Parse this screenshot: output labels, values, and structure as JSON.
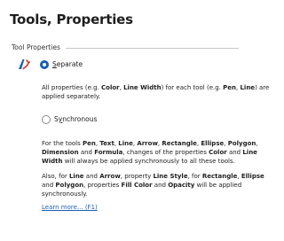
{
  "page": {
    "title": "Tools, Properties"
  },
  "group": {
    "title": "Tool Properties"
  },
  "options": {
    "separate": {
      "label_pre": "",
      "label_accel": "S",
      "label_post": "eparate",
      "checked": true
    },
    "synchronous": {
      "label_pre": "S",
      "label_accel": "y",
      "label_post": "nchronous",
      "checked": false
    }
  },
  "separate_desc": {
    "t1": "All properties (e.g. ",
    "b1": "Color",
    "t2": ", ",
    "b2": "Line Width",
    "t3": ") for each tool (e.g. ",
    "b3": "Pen",
    "t4": ", ",
    "b4": "Line",
    "t5": ") are applied separately."
  },
  "synchronous_desc1": {
    "t1": "For the tools ",
    "b1": "Pen",
    "t2": ", ",
    "b2": "Text",
    "t3": ", ",
    "b3": "Line",
    "t4": ", ",
    "b4": "Arrow",
    "t5": ", ",
    "b5": "Rectangle",
    "t6": ", ",
    "b6": "Ellipse",
    "t7": ", ",
    "b7": "Polygon",
    "t8": ", ",
    "b8": "Dimension",
    "t9": " and ",
    "b9": "Formula",
    "t10": ", changes of the properties ",
    "b10": "Color",
    "t11": " and ",
    "b11": "Line Width",
    "t12": " will always be applied synchronously to all these tools."
  },
  "synchronous_desc2": {
    "t1": "Also, for ",
    "b1": "Line",
    "t2": " and ",
    "b2": "Arrow",
    "t3": ", property ",
    "b3": "Line Style",
    "t4": ", for ",
    "b4": "Rectangle",
    "t5": ", ",
    "b5": "Ellipse",
    "t6": " and ",
    "b6": "Polygon",
    "t7": ", properties ",
    "b7": "Fill Color",
    "t8": " and ",
    "b8": "Opacity",
    "t9": " will be applied synchronously."
  },
  "links": {
    "learn_more": "Learn more... (F1)"
  },
  "icons": {
    "tool_icon": "pen-properties-icon"
  },
  "colors": {
    "accent": "#1a5fb4",
    "icon_red": "#d9342b"
  }
}
